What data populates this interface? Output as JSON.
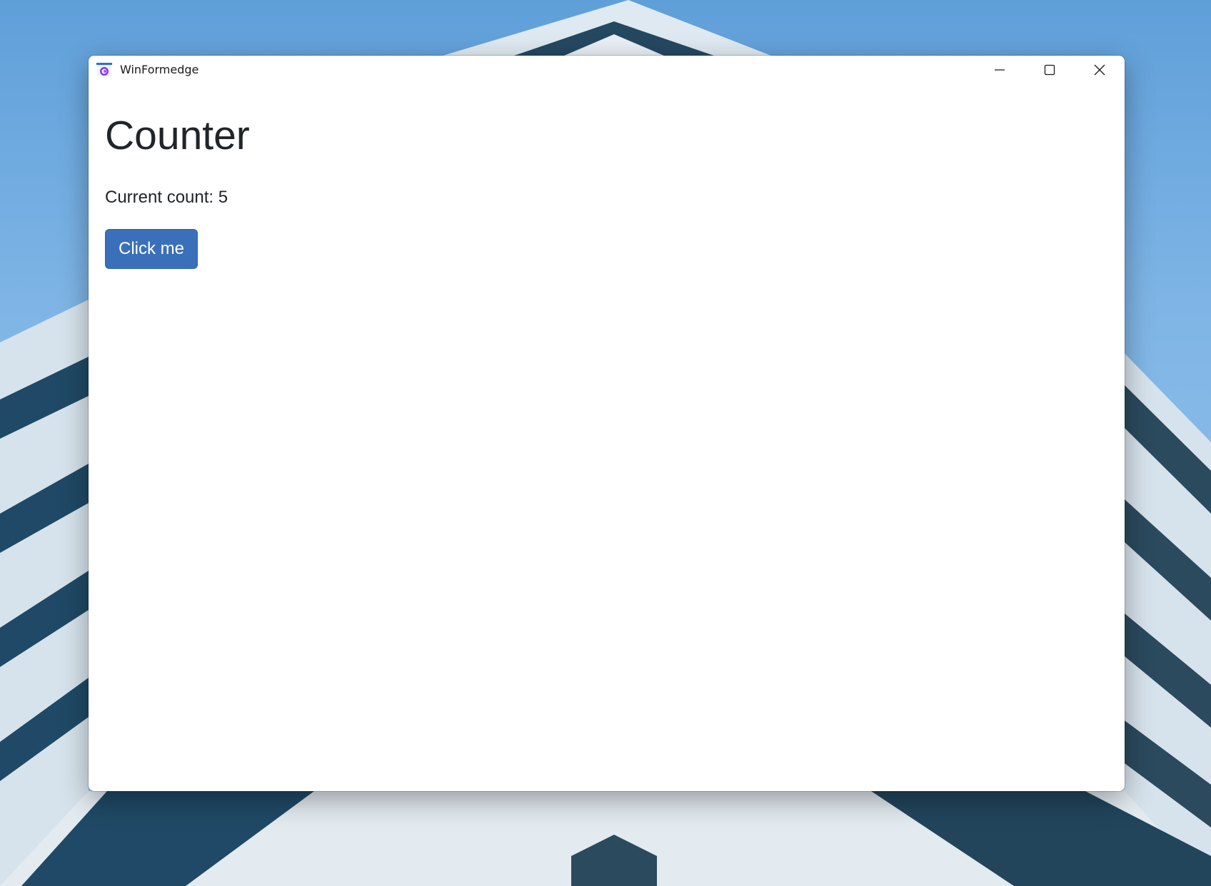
{
  "window": {
    "title": "WinFormedge",
    "app_icon": "winformedge-app-icon",
    "controls": {
      "minimize_icon": "minimize-icon",
      "maximize_icon": "maximize-icon",
      "close_icon": "close-icon"
    }
  },
  "page": {
    "title": "Counter",
    "count_text": "Current count: 5",
    "button_label": "Click me"
  },
  "colors": {
    "primary_button": "#3a70b9",
    "text": "#212529",
    "window_background": "#ffffff",
    "desktop_sky": "#7fb5e6"
  }
}
